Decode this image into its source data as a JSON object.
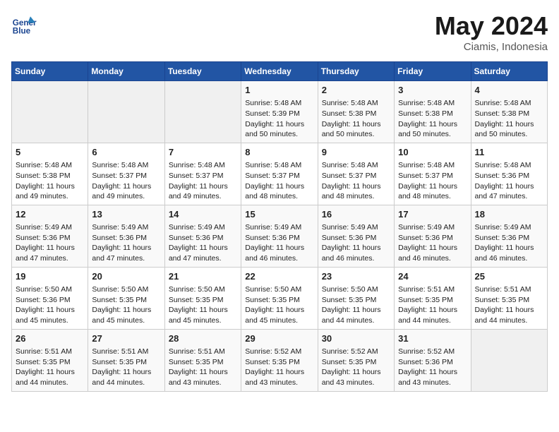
{
  "logo": {
    "line1": "General",
    "line2": "Blue"
  },
  "title": "May 2024",
  "location": "Ciamis, Indonesia",
  "days_header": [
    "Sunday",
    "Monday",
    "Tuesday",
    "Wednesday",
    "Thursday",
    "Friday",
    "Saturday"
  ],
  "weeks": [
    [
      {
        "day": "",
        "info": ""
      },
      {
        "day": "",
        "info": ""
      },
      {
        "day": "",
        "info": ""
      },
      {
        "day": "1",
        "info": "Sunrise: 5:48 AM\nSunset: 5:39 PM\nDaylight: 11 hours and 50 minutes."
      },
      {
        "day": "2",
        "info": "Sunrise: 5:48 AM\nSunset: 5:38 PM\nDaylight: 11 hours and 50 minutes."
      },
      {
        "day": "3",
        "info": "Sunrise: 5:48 AM\nSunset: 5:38 PM\nDaylight: 11 hours and 50 minutes."
      },
      {
        "day": "4",
        "info": "Sunrise: 5:48 AM\nSunset: 5:38 PM\nDaylight: 11 hours and 50 minutes."
      }
    ],
    [
      {
        "day": "5",
        "info": "Sunrise: 5:48 AM\nSunset: 5:38 PM\nDaylight: 11 hours and 49 minutes."
      },
      {
        "day": "6",
        "info": "Sunrise: 5:48 AM\nSunset: 5:37 PM\nDaylight: 11 hours and 49 minutes."
      },
      {
        "day": "7",
        "info": "Sunrise: 5:48 AM\nSunset: 5:37 PM\nDaylight: 11 hours and 49 minutes."
      },
      {
        "day": "8",
        "info": "Sunrise: 5:48 AM\nSunset: 5:37 PM\nDaylight: 11 hours and 48 minutes."
      },
      {
        "day": "9",
        "info": "Sunrise: 5:48 AM\nSunset: 5:37 PM\nDaylight: 11 hours and 48 minutes."
      },
      {
        "day": "10",
        "info": "Sunrise: 5:48 AM\nSunset: 5:37 PM\nDaylight: 11 hours and 48 minutes."
      },
      {
        "day": "11",
        "info": "Sunrise: 5:48 AM\nSunset: 5:36 PM\nDaylight: 11 hours and 47 minutes."
      }
    ],
    [
      {
        "day": "12",
        "info": "Sunrise: 5:49 AM\nSunset: 5:36 PM\nDaylight: 11 hours and 47 minutes."
      },
      {
        "day": "13",
        "info": "Sunrise: 5:49 AM\nSunset: 5:36 PM\nDaylight: 11 hours and 47 minutes."
      },
      {
        "day": "14",
        "info": "Sunrise: 5:49 AM\nSunset: 5:36 PM\nDaylight: 11 hours and 47 minutes."
      },
      {
        "day": "15",
        "info": "Sunrise: 5:49 AM\nSunset: 5:36 PM\nDaylight: 11 hours and 46 minutes."
      },
      {
        "day": "16",
        "info": "Sunrise: 5:49 AM\nSunset: 5:36 PM\nDaylight: 11 hours and 46 minutes."
      },
      {
        "day": "17",
        "info": "Sunrise: 5:49 AM\nSunset: 5:36 PM\nDaylight: 11 hours and 46 minutes."
      },
      {
        "day": "18",
        "info": "Sunrise: 5:49 AM\nSunset: 5:36 PM\nDaylight: 11 hours and 46 minutes."
      }
    ],
    [
      {
        "day": "19",
        "info": "Sunrise: 5:50 AM\nSunset: 5:36 PM\nDaylight: 11 hours and 45 minutes."
      },
      {
        "day": "20",
        "info": "Sunrise: 5:50 AM\nSunset: 5:35 PM\nDaylight: 11 hours and 45 minutes."
      },
      {
        "day": "21",
        "info": "Sunrise: 5:50 AM\nSunset: 5:35 PM\nDaylight: 11 hours and 45 minutes."
      },
      {
        "day": "22",
        "info": "Sunrise: 5:50 AM\nSunset: 5:35 PM\nDaylight: 11 hours and 45 minutes."
      },
      {
        "day": "23",
        "info": "Sunrise: 5:50 AM\nSunset: 5:35 PM\nDaylight: 11 hours and 44 minutes."
      },
      {
        "day": "24",
        "info": "Sunrise: 5:51 AM\nSunset: 5:35 PM\nDaylight: 11 hours and 44 minutes."
      },
      {
        "day": "25",
        "info": "Sunrise: 5:51 AM\nSunset: 5:35 PM\nDaylight: 11 hours and 44 minutes."
      }
    ],
    [
      {
        "day": "26",
        "info": "Sunrise: 5:51 AM\nSunset: 5:35 PM\nDaylight: 11 hours and 44 minutes."
      },
      {
        "day": "27",
        "info": "Sunrise: 5:51 AM\nSunset: 5:35 PM\nDaylight: 11 hours and 44 minutes."
      },
      {
        "day": "28",
        "info": "Sunrise: 5:51 AM\nSunset: 5:35 PM\nDaylight: 11 hours and 43 minutes."
      },
      {
        "day": "29",
        "info": "Sunrise: 5:52 AM\nSunset: 5:35 PM\nDaylight: 11 hours and 43 minutes."
      },
      {
        "day": "30",
        "info": "Sunrise: 5:52 AM\nSunset: 5:35 PM\nDaylight: 11 hours and 43 minutes."
      },
      {
        "day": "31",
        "info": "Sunrise: 5:52 AM\nSunset: 5:36 PM\nDaylight: 11 hours and 43 minutes."
      },
      {
        "day": "",
        "info": ""
      }
    ]
  ]
}
